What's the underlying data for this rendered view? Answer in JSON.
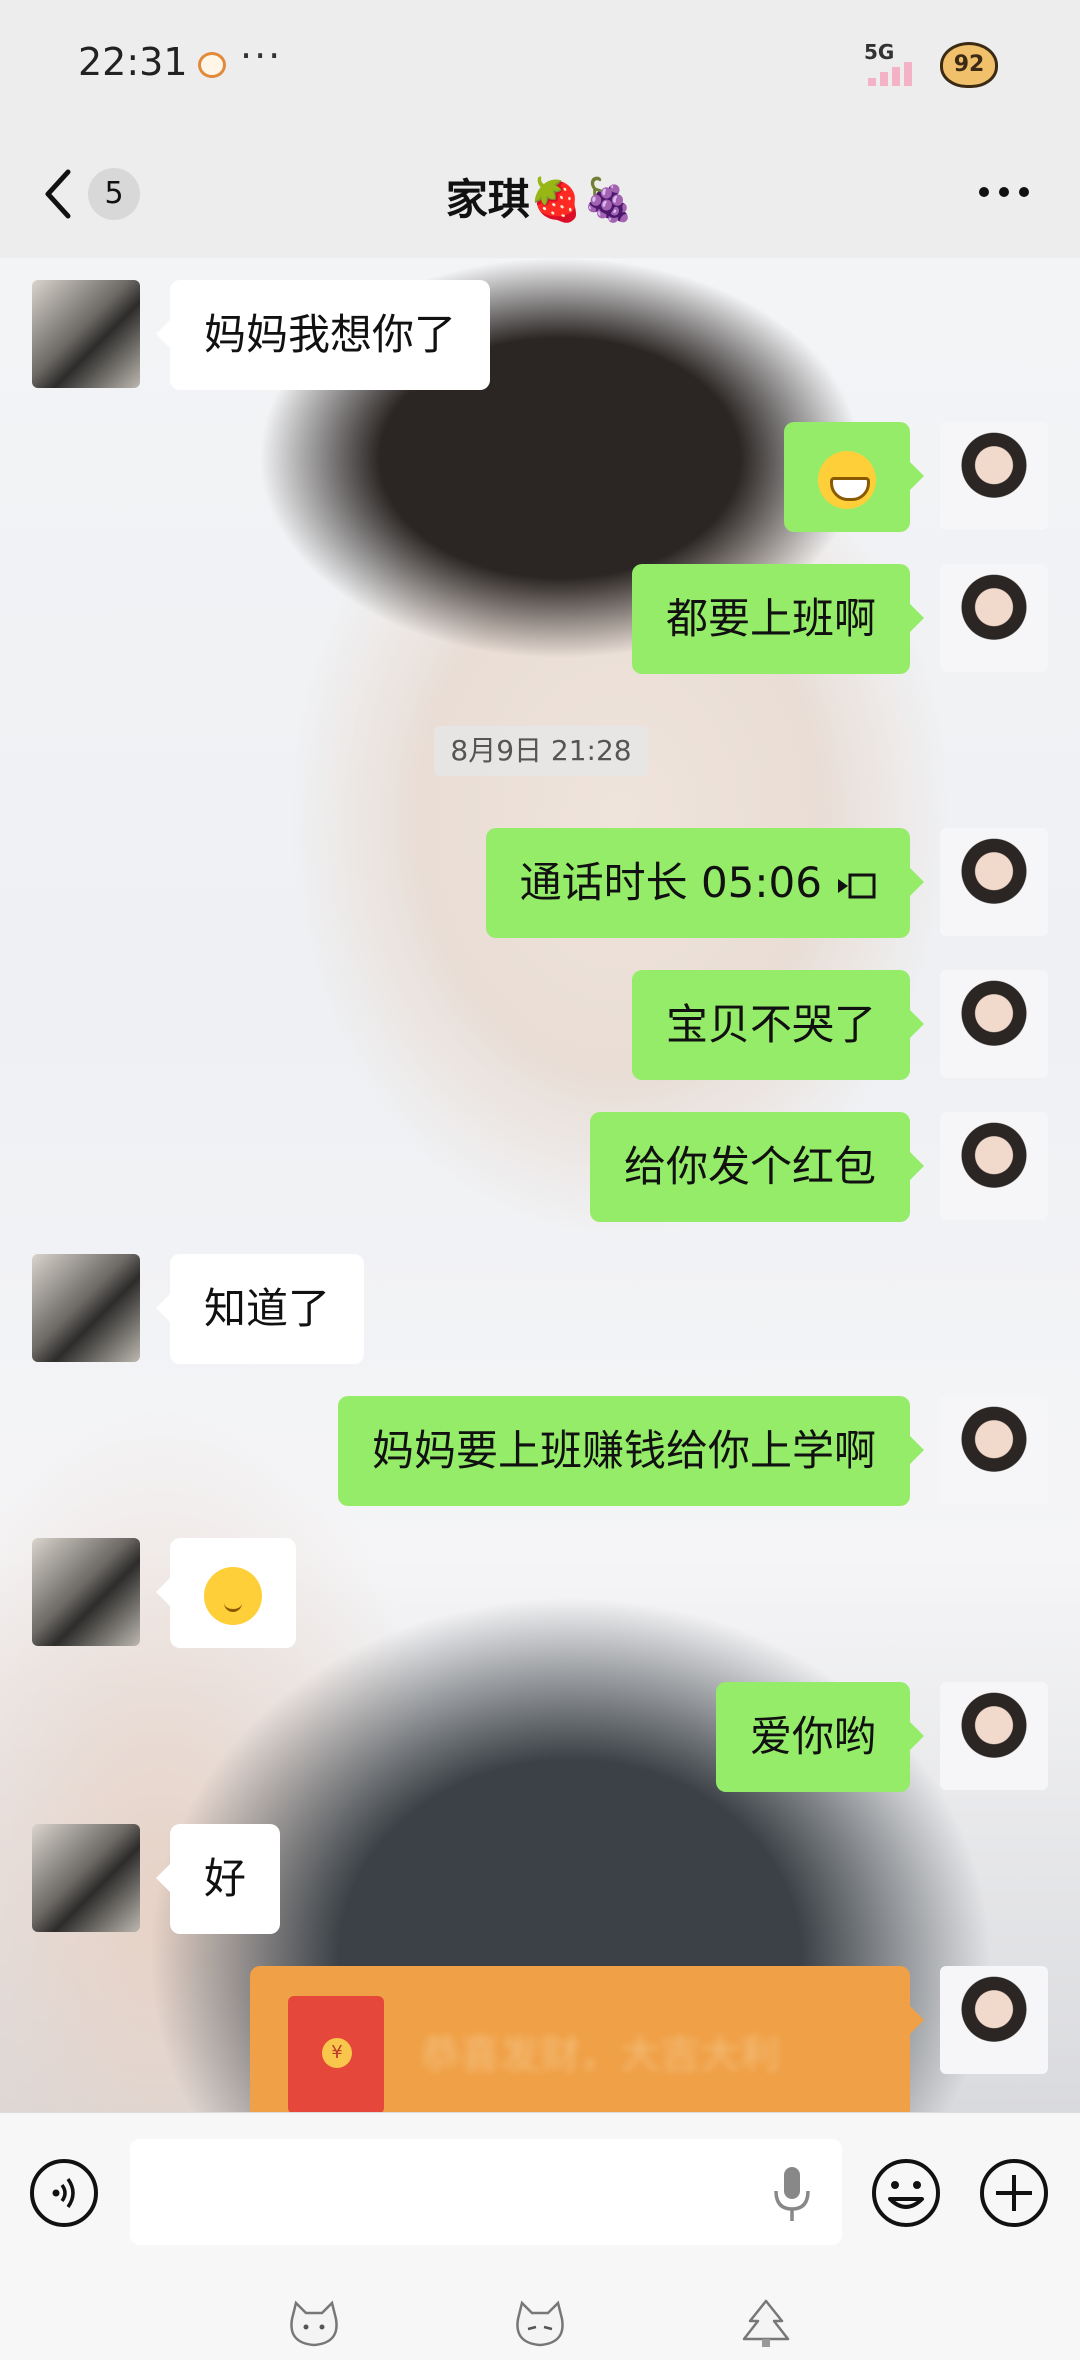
{
  "status_bar": {
    "time": "22:31",
    "more": "···",
    "network": "5G",
    "battery": "92"
  },
  "nav": {
    "unread_count": "5",
    "title": "家琪🍓🍇"
  },
  "messages": [
    {
      "side": "left",
      "text": "妈妈我想你了"
    },
    {
      "side": "right",
      "text": "",
      "emoji": "grin-emoji"
    },
    {
      "side": "right",
      "text": "都要上班啊"
    },
    {
      "side": "right",
      "text": "通话时长 05:06",
      "icon": "video-call-icon"
    },
    {
      "side": "right",
      "text": "宝贝不哭了"
    },
    {
      "side": "right",
      "text": "给你发个红包"
    },
    {
      "side": "left",
      "text": "知道了"
    },
    {
      "side": "right",
      "text": "妈妈要上班赚钱给你上学啊"
    },
    {
      "side": "left",
      "text": "",
      "emoji": "shy-smile-emoji"
    },
    {
      "side": "right",
      "text": "爱你哟"
    },
    {
      "side": "left",
      "text": "好"
    }
  ],
  "timestamp": "8月9日 21:28",
  "red_packet": {
    "coin_symbol": "¥",
    "blurred_text": "恭喜发财，大吉大利"
  },
  "colors": {
    "bubble_self": "#95ec69",
    "bubble_other": "#ffffff",
    "red_packet": "#f0a046"
  }
}
